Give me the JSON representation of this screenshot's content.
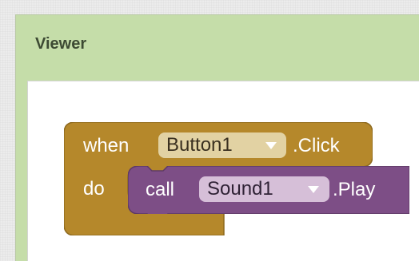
{
  "viewer": {
    "title": "Viewer"
  },
  "event_block": {
    "when_label": "when",
    "component": "Button1",
    "event": ".Click",
    "do_label": "do",
    "color": "#b5882b"
  },
  "call_block": {
    "call_label": "call",
    "component": "Sound1",
    "method": ".Play",
    "color": "#7d4e86"
  },
  "icons": {
    "dropdown": "chevron-down-icon"
  }
}
